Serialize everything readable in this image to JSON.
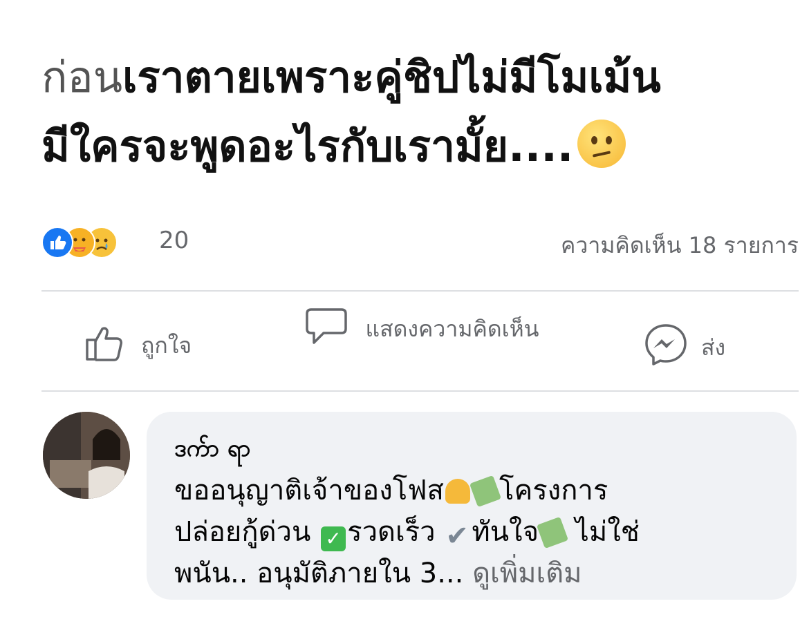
{
  "post": {
    "text_gray": "ก่อน",
    "text_line1_rest": "เราตายเพราะคู่ชิปไม่มีโมเม้น",
    "text_line2": "มีใครจะพูดอะไรกับเรามั้ย....",
    "trailing_emoji": "confused-face"
  },
  "stats": {
    "reactions": [
      "like",
      "care",
      "sad"
    ],
    "reaction_count": "20",
    "comment_count": "ความคิดเห็น 18 รายการ"
  },
  "actions": {
    "like": "ถูกใจ",
    "comment": "แสดงความคิดเห็น",
    "share": "ส่ง"
  },
  "comment": {
    "author": "ဒက်ာ ရာ",
    "body_1": "ขออนุญาติเจ้าของโฟส",
    "body_2": "โครงการ",
    "body_3": "ปล่อยกู้ด่วน ",
    "body_4": "รวดเร็ว ",
    "body_5": "ทันใจ",
    "body_6": " ไม่ใช่",
    "body_7": "พนัน.. อนุมัติภายใน 3... ",
    "see_more": "ดูเพิ่มเติม"
  },
  "colors": {
    "like_blue": "#1877f2",
    "meta_gray": "#65676b",
    "bubble_bg": "#f0f2f5",
    "divider": "#dddfe2"
  }
}
